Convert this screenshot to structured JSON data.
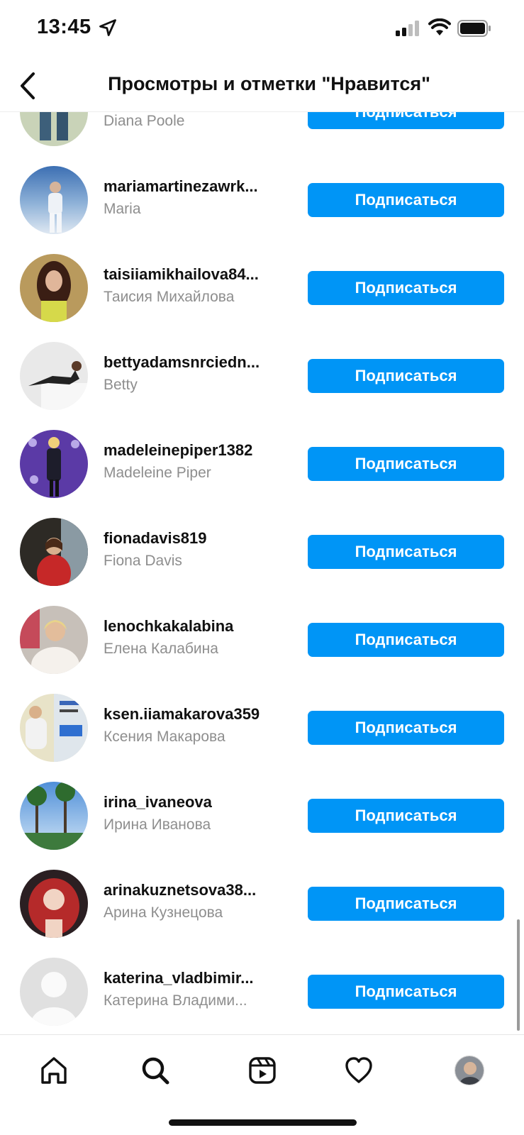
{
  "status_bar": {
    "time": "13:45",
    "icons": [
      "location-arrow-icon",
      "cellular-signal-icon",
      "wifi-icon",
      "battery-icon"
    ]
  },
  "header": {
    "title": "Просмотры и отметки \"Нравится\"",
    "back_icon": "chevron-left-icon"
  },
  "follow_label": "Подписаться",
  "users": [
    {
      "username": "",
      "fullname": "Diana Poole"
    },
    {
      "username": "mariamartinezawrk...",
      "fullname": "Maria"
    },
    {
      "username": "taisiiamikhailova84...",
      "fullname": "Таисия Михайлова"
    },
    {
      "username": "bettyadamsnrciedn...",
      "fullname": "Betty"
    },
    {
      "username": "madeleinepiper1382",
      "fullname": "Madeleine Piper"
    },
    {
      "username": "fionadavis819",
      "fullname": "Fiona Davis"
    },
    {
      "username": "lenochkakalabina",
      "fullname": "Елена Калабина"
    },
    {
      "username": "ksen.iiamakarova359",
      "fullname": "Ксения Макарова"
    },
    {
      "username": "irina_ivaneova",
      "fullname": "Ирина Иванова"
    },
    {
      "username": "arinakuznetsova38...",
      "fullname": "Арина Кузнецова"
    },
    {
      "username": "katerina_vladbimir...",
      "fullname": "Катерина Владими..."
    }
  ],
  "tab_bar": {
    "tabs": [
      "home-icon",
      "search-icon",
      "reels-icon",
      "heart-icon",
      "profile-avatar"
    ]
  },
  "colors": {
    "accent": "#0095f6",
    "secondary_text": "#8e8e8e"
  }
}
